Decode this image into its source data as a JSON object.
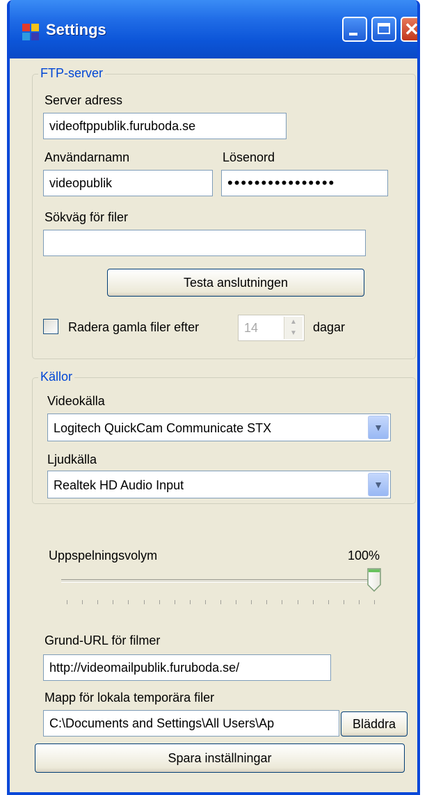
{
  "window": {
    "title": "Settings"
  },
  "ftp": {
    "legend": "FTP-server",
    "server_label": "Server adress",
    "server_value": "videoftppublik.furuboda.se",
    "user_label": "Användarnamn",
    "user_value": "videopublik",
    "password_label": "Lösenord",
    "password_value": "••••••••••••••••",
    "path_label": "Sökväg för filer",
    "path_value": "",
    "test_button": "Testa anslutningen",
    "delete_label": "Radera gamla filer efter",
    "delete_checked": false,
    "days_value": "14",
    "days_unit": "dagar"
  },
  "sources": {
    "legend": "Källor",
    "video_label": "Videokälla",
    "video_value": "Logitech QuickCam Communicate STX",
    "audio_label": "Ljudkälla",
    "audio_value": "Realtek HD Audio Input"
  },
  "volume": {
    "label": "Uppspelningsvolym",
    "value_text": "100%",
    "value": 1.0
  },
  "base_url": {
    "label": "Grund-URL för filmer",
    "value": "http://videomailpublik.furuboda.se/"
  },
  "temp_folder": {
    "label": "Mapp för lokala temporära filer",
    "value": "C:\\Documents and Settings\\All Users\\Ap",
    "browse_button": "Bläddra"
  },
  "save_button": "Spara inställningar",
  "colors": {
    "titlebar": "#0a4ac6",
    "legend_text": "#0046d5",
    "window_bg": "#ece9d8",
    "close_button": "#c2361b"
  },
  "icons": [
    "app-icon",
    "minimize-icon",
    "maximize-icon",
    "close-icon",
    "spin-up-icon",
    "spin-down-icon",
    "chevron-down-icon",
    "slider-thumb-icon"
  ]
}
